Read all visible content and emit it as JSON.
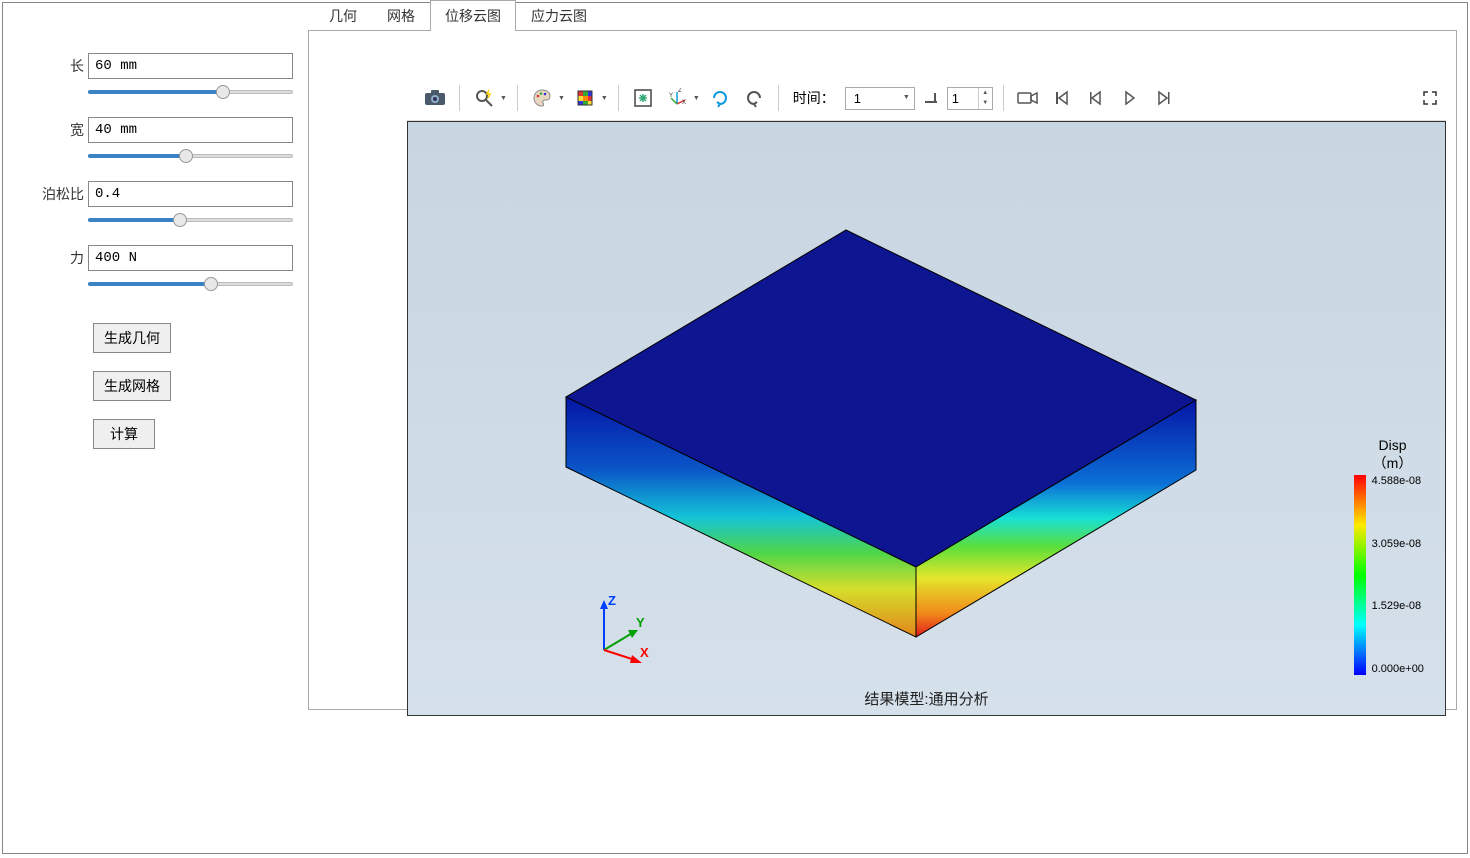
{
  "sidebar": {
    "params": [
      {
        "label": "长",
        "value": "60 mm",
        "slider_pct": 66
      },
      {
        "label": "宽",
        "value": "40 mm",
        "slider_pct": 48
      },
      {
        "label": "泊松比",
        "value": "0.4",
        "slider_pct": 45
      },
      {
        "label": "力",
        "value": "400 N",
        "slider_pct": 60
      }
    ],
    "buttons": {
      "gen_geom": "生成几何",
      "gen_mesh": "生成网格",
      "compute": "计算"
    }
  },
  "tabs": {
    "items": [
      "几何",
      "网格",
      "位移云图",
      "应力云图"
    ],
    "active_index": 2
  },
  "toolbar": {
    "time_label": "时间：",
    "time_dropdown": "1",
    "time_spinner": "1"
  },
  "viewport": {
    "footer": "结果模型:通用分析",
    "axes": {
      "x": "X",
      "y": "Y",
      "z": "Z"
    },
    "legend": {
      "title1": "Disp",
      "title2": "（m）",
      "ticks": [
        "4.588e-08",
        "3.059e-08",
        "1.529e-08",
        "0.000e+00"
      ]
    }
  }
}
